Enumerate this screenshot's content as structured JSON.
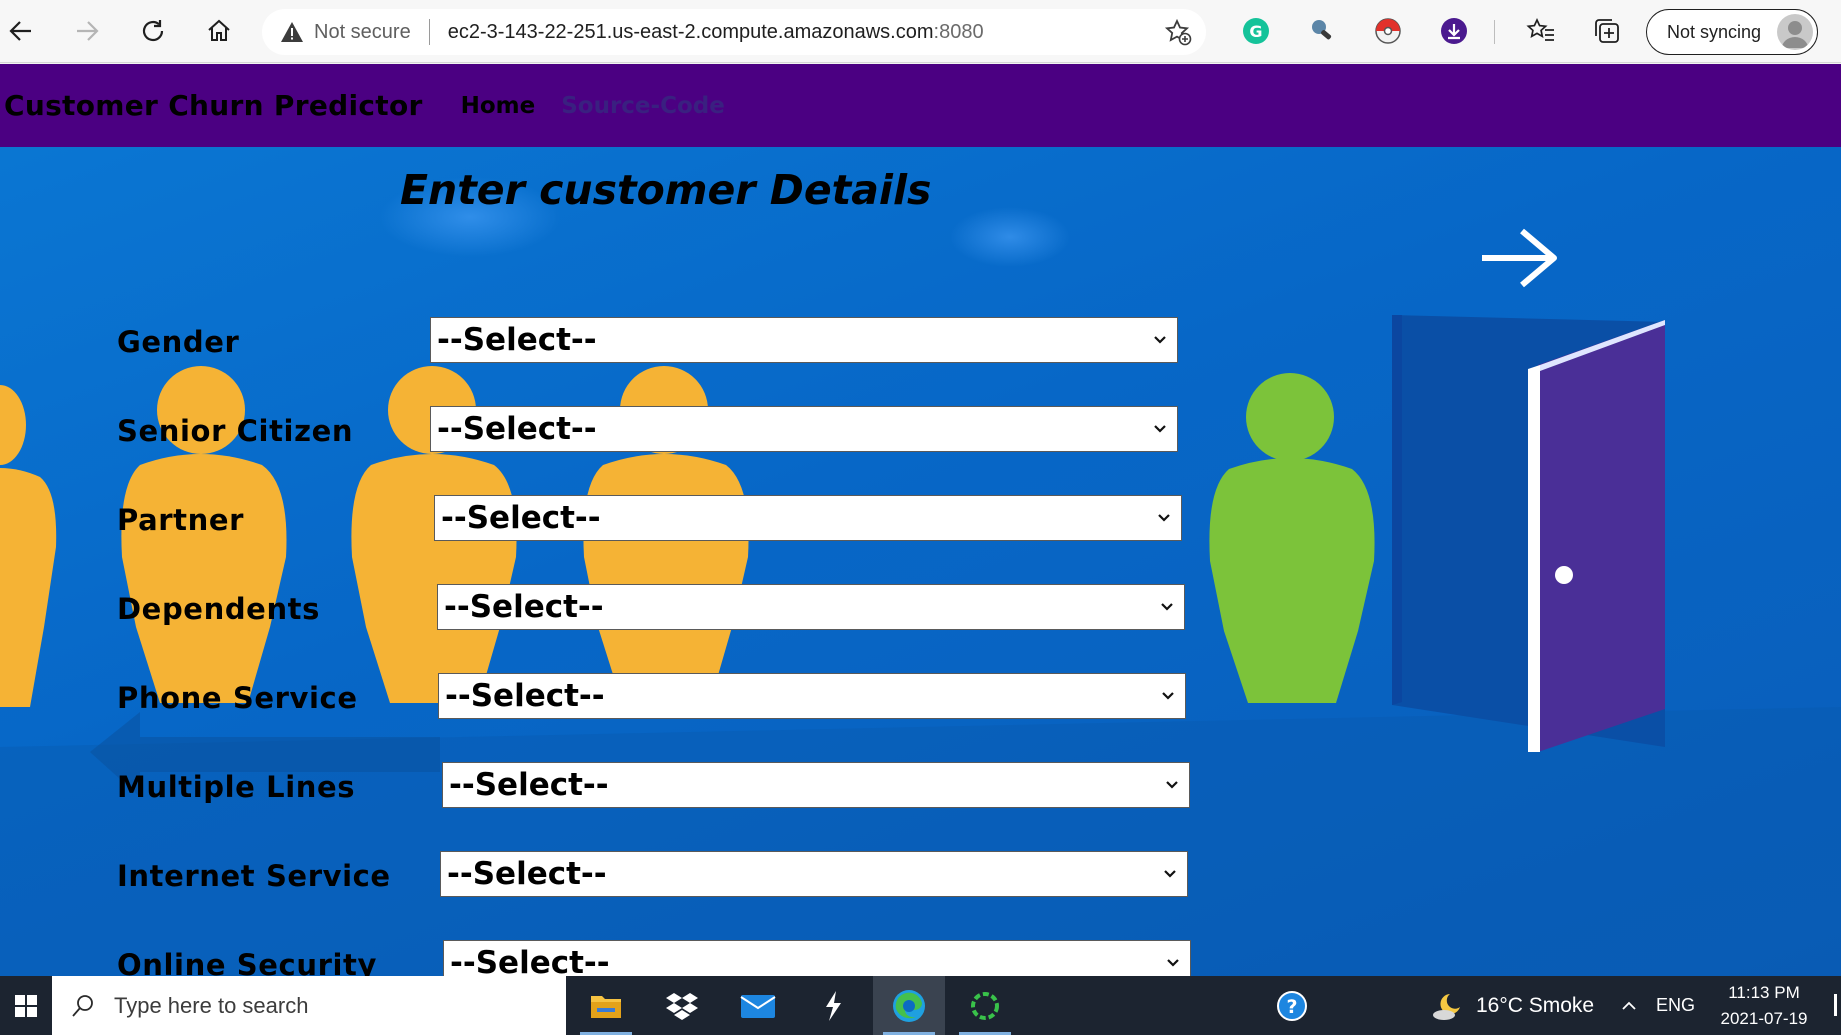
{
  "browser": {
    "security_label": "Not secure",
    "url_host": "ec2-3-143-22-251.us-east-2.compute.amazonaws.com",
    "url_port": ":8080",
    "sync_label": "Not syncing"
  },
  "page": {
    "brand": "Customer Churn Predictor",
    "nav": {
      "home": "Home",
      "source": "Source-Code"
    },
    "heading": "Enter customer Details",
    "fields": [
      {
        "label": "Gender",
        "value": "--Select--"
      },
      {
        "label": "Senior Citizen",
        "value": "--Select--"
      },
      {
        "label": "Partner",
        "value": "--Select--"
      },
      {
        "label": "Dependents",
        "value": "--Select--"
      },
      {
        "label": "Phone Service",
        "value": "--Select--"
      },
      {
        "label": "Multiple Lines",
        "value": "--Select--"
      },
      {
        "label": "Internet Service",
        "value": "--Select--"
      },
      {
        "label": "Online Security",
        "value": "--Select--"
      }
    ]
  },
  "taskbar": {
    "search_placeholder": "Type here to search",
    "weather": "16°C  Smoke",
    "language": "ENG",
    "time": "11:13 PM",
    "date": "2021-07-19"
  },
  "colors": {
    "nav_bg": "#4b0082",
    "page_bg": "#0767c7",
    "person_yellow": "#f5b335",
    "person_green": "#7cc33a",
    "door": "#4a2f97"
  },
  "icons": [
    "back-icon",
    "forward-icon",
    "refresh-icon",
    "home-icon",
    "warning-icon",
    "add-favorite-icon",
    "grammarly-icon",
    "extension-icon",
    "pokeball-icon",
    "download-icon",
    "favorites-icon",
    "collections-icon",
    "windows-icon",
    "search-icon",
    "file-explorer-icon",
    "dropbox-icon",
    "mail-icon",
    "edge-icon",
    "help-icon",
    "chevron-down-icon"
  ]
}
